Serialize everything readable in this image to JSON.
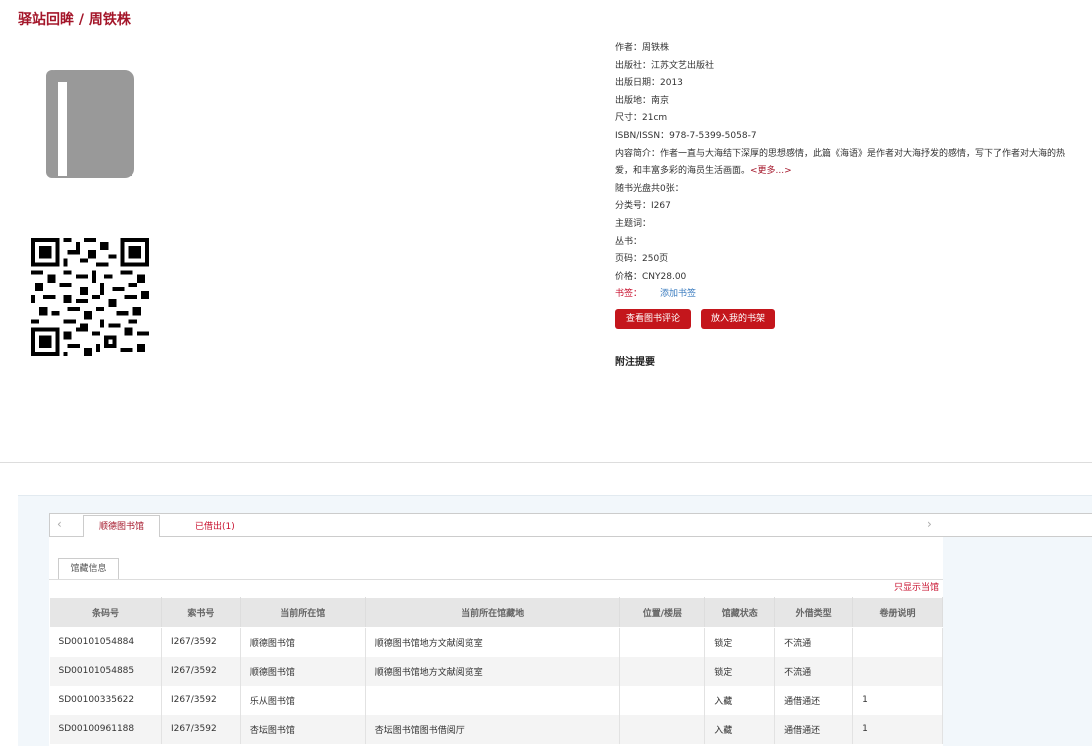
{
  "title": "驿站回眸 / 周铁株",
  "book": {
    "author": "作者：周铁株",
    "publisher": "出版社：江苏文艺出版社",
    "pubdate": "出版日期：2013",
    "place": "出版地：南京",
    "size": "尺寸：21cm",
    "isbn": "ISBN/ISSN：978-7-5399-5058-7",
    "summary": "内容简介：作者一直与大海结下深厚的思想感情，此篇《海语》是作者对大海抒发的感情，写下了作者对大海的热爱，和丰富多彩的海员生活画面。",
    "more": "<更多...>",
    "cd": "随书光盘共0张：",
    "class_no": "分类号：I267",
    "subject": "主题词：",
    "series": "丛书：",
    "pages": "页码：250页",
    "price": "价格：CNY28.00",
    "tag_label": "书签：",
    "tag_link": "添加书签"
  },
  "buttons": {
    "reviews": "查看图书评论",
    "shelf": "放入我的书架"
  },
  "fuzhu": "附注提要",
  "tabs": {
    "tab1": "顺德图书馆",
    "tab2": "已借出(1)",
    "prev": "‹",
    "next": "›"
  },
  "subtab": "馆藏信息",
  "only_show": "只显示当馆",
  "holdings": {
    "headers": [
      "条码号",
      "索书号",
      "当前所在馆",
      "当前所在馆藏地",
      "位置/楼层",
      "馆藏状态",
      "外借类型",
      "卷册说明"
    ],
    "rows": [
      [
        "SD00101054884",
        "I267/3592",
        "顺德图书馆",
        "顺德图书馆地方文献阅览室",
        "",
        "锁定",
        "不流通",
        ""
      ],
      [
        "SD00101054885",
        "I267/3592",
        "顺德图书馆",
        "顺德图书馆地方文献阅览室",
        "",
        "锁定",
        "不流通",
        ""
      ],
      [
        "SD00100335622",
        "I267/3592",
        "乐从图书馆",
        "",
        "",
        "入藏",
        "通借通还",
        "1"
      ],
      [
        "SD00100961188",
        "I267/3592",
        "杏坛图书馆",
        "杏坛图书馆图书借阅厅",
        "",
        "入藏",
        "通借通还",
        "1"
      ]
    ]
  },
  "colors": {
    "brand": "#a4162a",
    "button": "#c4161c",
    "link": "#3a7bbf"
  }
}
